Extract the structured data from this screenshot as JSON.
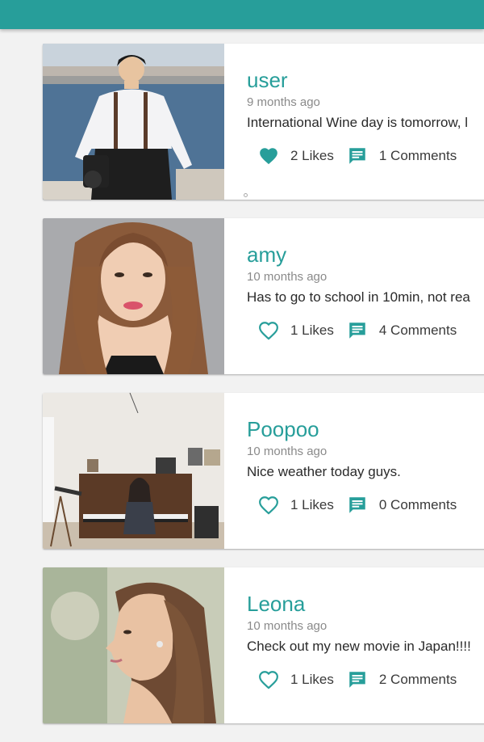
{
  "colors": {
    "accent": "#279e9a",
    "background": "#f2f2f2",
    "card": "#ffffff"
  },
  "posts": [
    {
      "user": "user",
      "time": "9 months ago",
      "message": "International Wine day is tomorrow, l",
      "likes_label": "2 Likes",
      "comments_label": "1 Comments",
      "liked": true,
      "like_icon": "heart-filled-icon",
      "comment_icon": "comment-icon"
    },
    {
      "user": "amy",
      "time": "10 months ago",
      "message": "Has to go to school in 10min, not rea",
      "likes_label": "1 Likes",
      "comments_label": "4 Comments",
      "liked": false,
      "like_icon": "heart-outline-icon",
      "comment_icon": "comment-icon"
    },
    {
      "user": "Poopoo",
      "time": "10 months ago",
      "message": "Nice weather today guys.",
      "likes_label": "1 Likes",
      "comments_label": "0 Comments",
      "liked": false,
      "like_icon": "heart-outline-icon",
      "comment_icon": "comment-icon"
    },
    {
      "user": "Leona",
      "time": "10 months ago",
      "message": "Check out my new movie in Japan!!!!",
      "likes_label": "1 Likes",
      "comments_label": "2 Comments",
      "liked": false,
      "like_icon": "heart-outline-icon",
      "comment_icon": "comment-icon"
    }
  ]
}
